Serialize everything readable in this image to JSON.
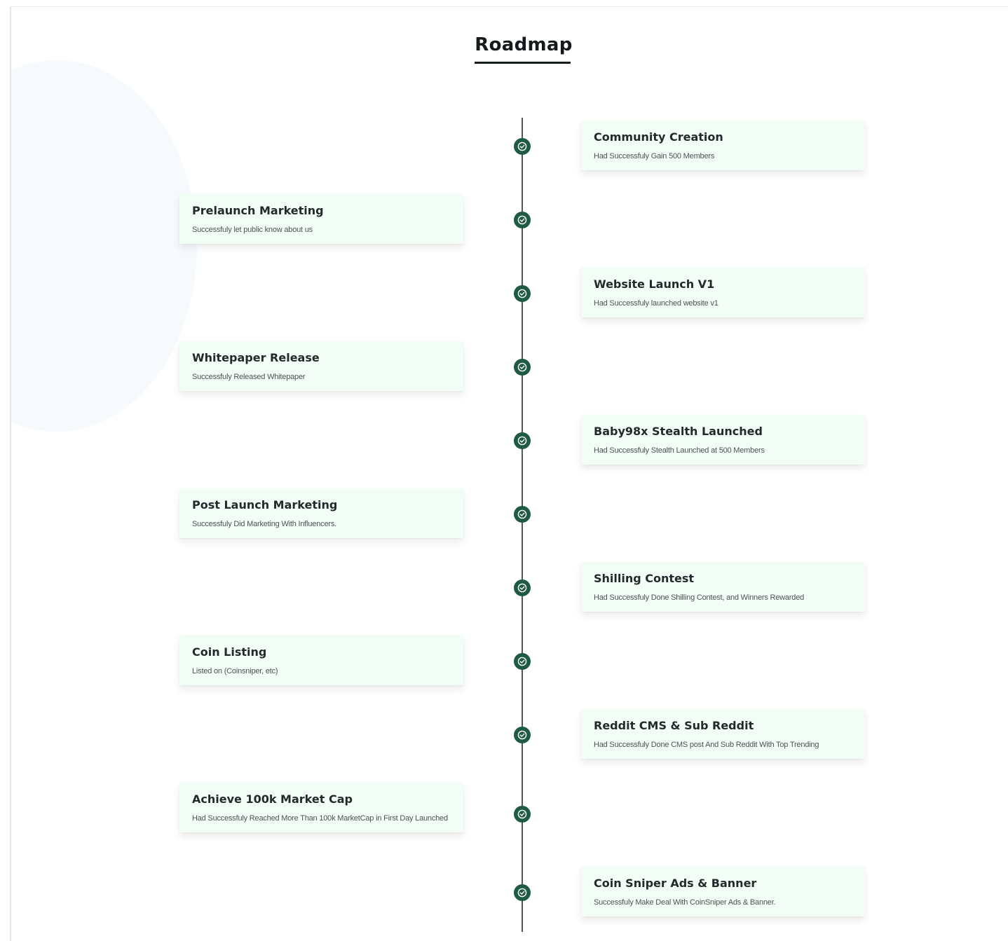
{
  "page": {
    "title": "Roadmap"
  },
  "colors": {
    "card_background": "#f2fdf6",
    "node_fill": "#1f5b43",
    "timeline_line": "#51595a",
    "title_text": "#151a1c"
  },
  "milestones": [
    {
      "side": "right",
      "title": "Community Creation",
      "description": "Had Successfuly Gain 500 Members",
      "icon": "check-circle-icon"
    },
    {
      "side": "left",
      "title": "Prelaunch Marketing",
      "description": "Successfuly let public know about us",
      "icon": "check-circle-icon"
    },
    {
      "side": "right",
      "title": "Website Launch V1",
      "description": "Had Successfuly launched website v1",
      "icon": "check-circle-icon"
    },
    {
      "side": "left",
      "title": "Whitepaper Release",
      "description": "Successfuly Released Whitepaper",
      "icon": "check-circle-icon"
    },
    {
      "side": "right",
      "title": "Baby98x Stealth Launched",
      "description": "Had Successfuly Stealth Launched at 500 Members",
      "icon": "check-circle-icon"
    },
    {
      "side": "left",
      "title": "Post Launch Marketing",
      "description": "Successfuly Did Marketing With Influencers.",
      "icon": "check-circle-icon"
    },
    {
      "side": "right",
      "title": "Shilling Contest",
      "description": "Had Successfuly Done Shilling Contest, and Winners Rewarded",
      "icon": "check-circle-icon"
    },
    {
      "side": "left",
      "title": "Coin Listing",
      "description": "Listed on (Coinsniper, etc)",
      "icon": "check-circle-icon"
    },
    {
      "side": "right",
      "title": "Reddit CMS & Sub Reddit",
      "description": "Had Successfuly Done CMS post And Sub Reddit With Top Trending",
      "icon": "check-circle-icon"
    },
    {
      "side": "left",
      "title": "Achieve 100k Market Cap",
      "description": "Had Successfuly Reached More Than 100k MarketCap in First Day Launched",
      "icon": "check-circle-icon"
    },
    {
      "side": "right",
      "title": "Coin Sniper Ads & Banner",
      "description": "Successfuly Make Deal With CoinSniper Ads & Banner.",
      "icon": "check-circle-icon"
    }
  ]
}
